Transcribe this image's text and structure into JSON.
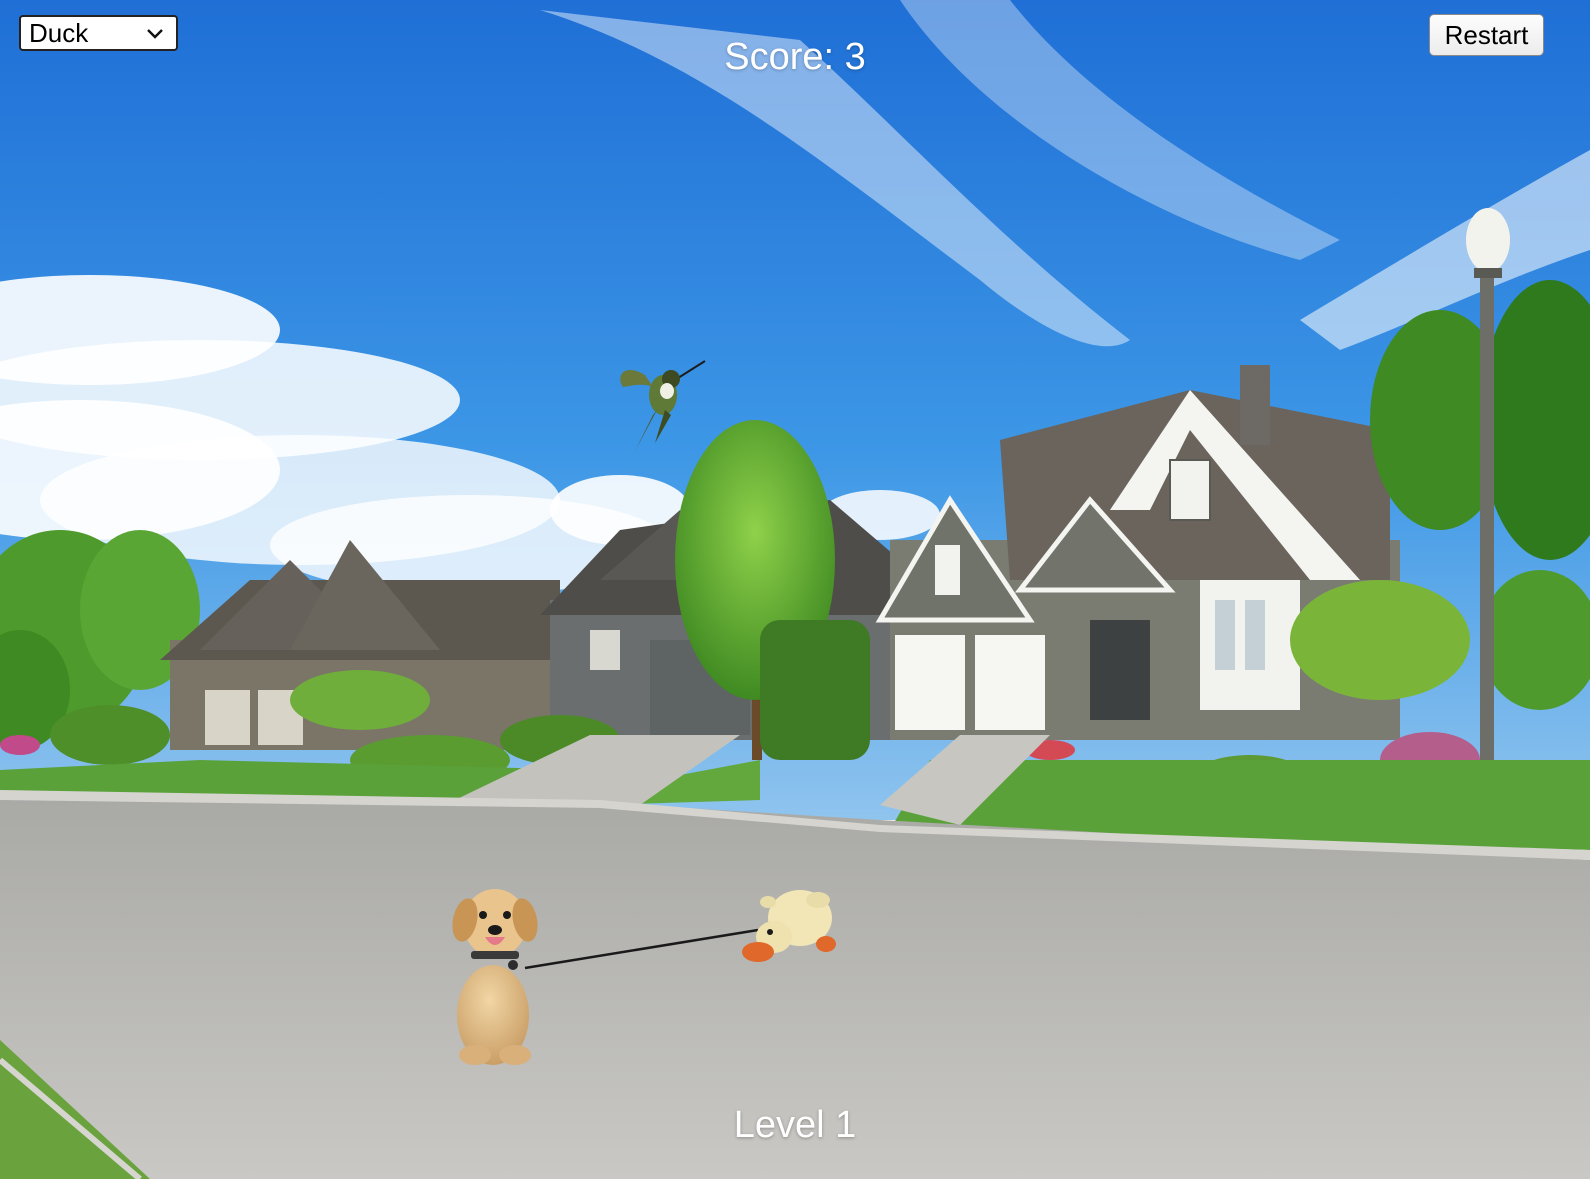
{
  "game": {
    "toy_select": {
      "selected": "Duck"
    },
    "restart_label": "Restart",
    "score_text": "Score: 3",
    "level_text": "Level 1"
  },
  "scene": {
    "setting": "suburban street",
    "characters": [
      "puppy",
      "duck-toy",
      "hummingbird"
    ]
  },
  "colors": {
    "sky": "#2e86e0",
    "road": "#b9b8b4",
    "lawn": "#5aa13a",
    "hud_text": "#ffffff"
  }
}
